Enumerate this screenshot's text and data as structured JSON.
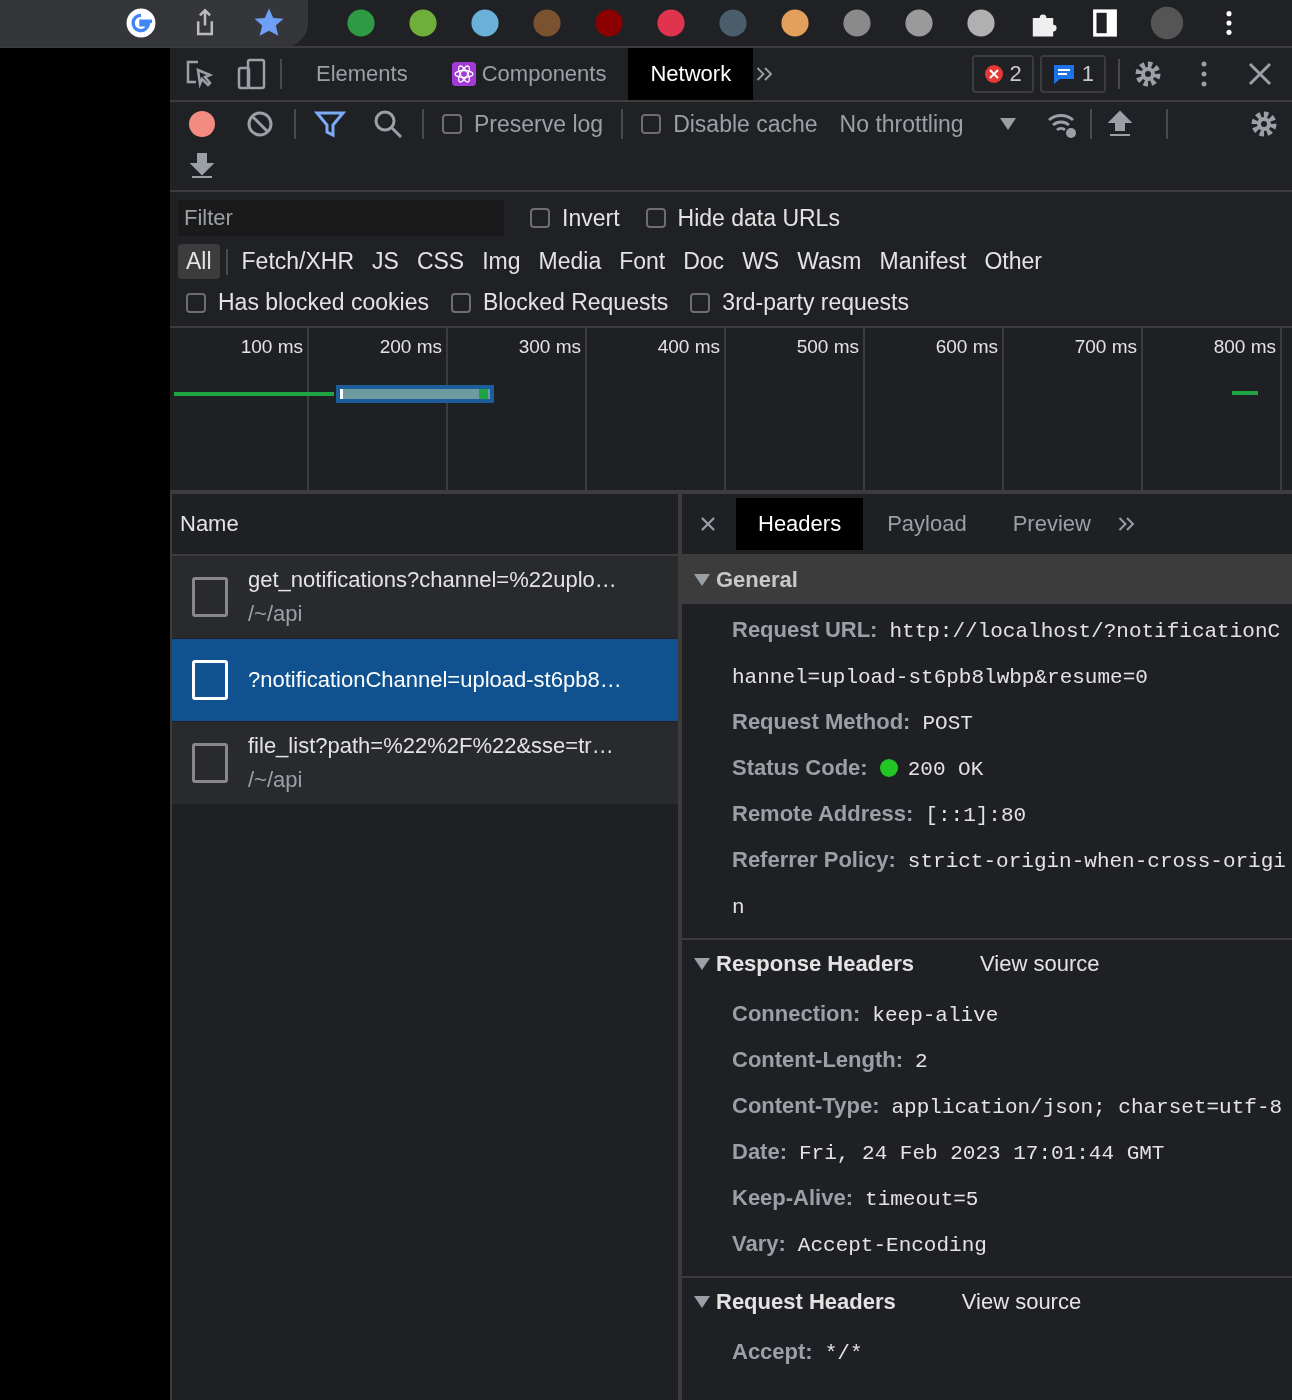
{
  "devtools": {
    "tabs": [
      {
        "label": "Elements",
        "selected": false,
        "kind": "plain"
      },
      {
        "label": "Components",
        "selected": false,
        "kind": "react"
      },
      {
        "label": "Network",
        "selected": true,
        "kind": "plain"
      }
    ],
    "error_count": "2",
    "message_count": "1"
  },
  "toolbar": {
    "recording": true,
    "preserve_log": {
      "label": "Preserve log",
      "checked": false
    },
    "disable_cache": {
      "label": "Disable cache",
      "checked": false
    },
    "throttling": "No throttling"
  },
  "filter": {
    "placeholder": "Filter",
    "invert": {
      "label": "Invert",
      "checked": false
    },
    "hide_data_urls": {
      "label": "Hide data URLs",
      "checked": false
    },
    "types": [
      {
        "label": "All",
        "selected": true
      },
      {
        "label": "Fetch/XHR",
        "selected": false
      },
      {
        "label": "JS",
        "selected": false
      },
      {
        "label": "CSS",
        "selected": false
      },
      {
        "label": "Img",
        "selected": false
      },
      {
        "label": "Media",
        "selected": false
      },
      {
        "label": "Font",
        "selected": false
      },
      {
        "label": "Doc",
        "selected": false
      },
      {
        "label": "WS",
        "selected": false
      },
      {
        "label": "Wasm",
        "selected": false
      },
      {
        "label": "Manifest",
        "selected": false
      },
      {
        "label": "Other",
        "selected": false
      }
    ],
    "options": [
      {
        "label": "Has blocked cookies",
        "checked": false
      },
      {
        "label": "Blocked Requests",
        "checked": false
      },
      {
        "label": "3rd-party requests",
        "checked": false
      }
    ]
  },
  "timeline": {
    "ticks": [
      "100 ms",
      "200 ms",
      "300 ms",
      "400 ms",
      "500 ms",
      "600 ms",
      "700 ms",
      "800 ms"
    ]
  },
  "requests": {
    "column": "Name",
    "rows": [
      {
        "name": "get_notifications?channel=%22uplo…",
        "path": "/~/api",
        "selected": false
      },
      {
        "name": "?notificationChannel=upload-st6pb8…",
        "selected": true
      },
      {
        "name": "file_list?path=%22%2F%22&sse=tr…",
        "path": "/~/api",
        "selected": false
      }
    ]
  },
  "details": {
    "tabs": [
      {
        "label": "Headers",
        "selected": true
      },
      {
        "label": "Payload",
        "selected": false
      },
      {
        "label": "Preview",
        "selected": false
      }
    ],
    "sections": [
      {
        "title": "General",
        "expanded": true,
        "highlighted": true,
        "rows": [
          {
            "key": "Request URL:",
            "value": "http://localhost/?notificationChannel=upload-st6pb8lwbp&resume=0",
            "kind": "text"
          },
          {
            "key": "Request Method:",
            "value": "POST",
            "kind": "text"
          },
          {
            "key": "Status Code:",
            "value": "200 OK",
            "kind": "status",
            "color": "#22c522"
          },
          {
            "key": "Remote Address:",
            "value": "[::1]:80",
            "kind": "text"
          },
          {
            "key": "Referrer Policy:",
            "value": "strict-origin-when-cross-origin",
            "kind": "text"
          }
        ]
      },
      {
        "title": "Response Headers",
        "expanded": true,
        "highlighted": false,
        "link": "View source",
        "rows": [
          {
            "key": "Connection:",
            "value": "keep-alive",
            "kind": "text"
          },
          {
            "key": "Content-Length:",
            "value": "2",
            "kind": "text"
          },
          {
            "key": "Content-Type:",
            "value": "application/json; charset=utf-8",
            "kind": "text"
          },
          {
            "key": "Date:",
            "value": "Fri, 24 Feb 2023 17:01:44 GMT",
            "kind": "text"
          },
          {
            "key": "Keep-Alive:",
            "value": "timeout=5",
            "kind": "text"
          },
          {
            "key": "Vary:",
            "value": "Accept-Encoding",
            "kind": "text"
          }
        ]
      },
      {
        "title": "Request Headers",
        "expanded": true,
        "highlighted": false,
        "link": "View source",
        "rows": [
          {
            "key": "Accept:",
            "value": "*/*",
            "kind": "text"
          }
        ]
      }
    ]
  }
}
